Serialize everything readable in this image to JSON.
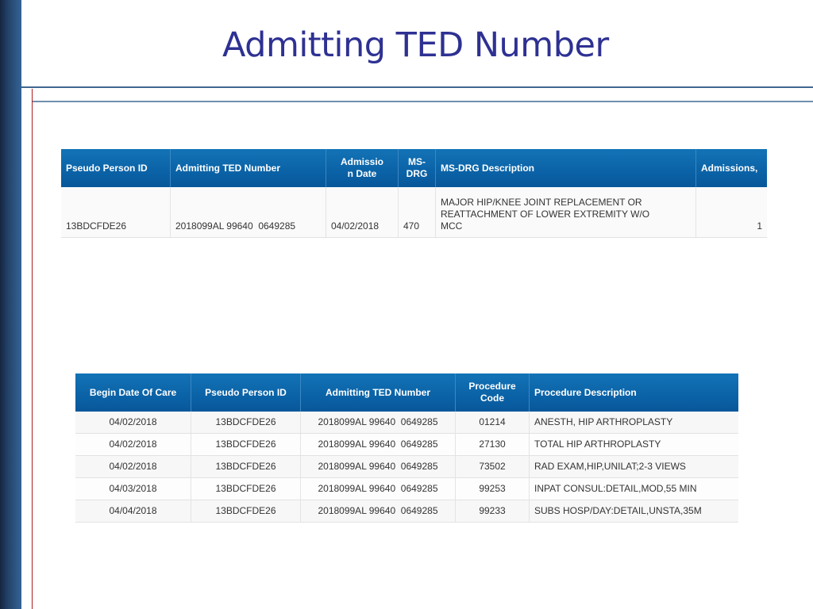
{
  "slide": {
    "title": "Admitting TED Number"
  },
  "admissions_table": {
    "headers": [
      "Pseudo Person ID",
      "Admitting TED Number",
      "Admissio n Date",
      "MS-DRG",
      "MS-DRG Description",
      "Admissions,"
    ],
    "rows": [
      {
        "pseudo_person_id": "13BDCFDE26",
        "admitting_ted_number": "2018099AL 99640  0649285",
        "admission_date": "04/02/2018",
        "ms_drg": "470",
        "ms_drg_description": "MAJOR HIP/KNEE JOINT REPLACEMENT OR REATTACHMENT OF LOWER EXTREMITY W/O MCC",
        "admissions": "1"
      }
    ]
  },
  "procedures_table": {
    "headers": [
      "Begin Date Of Care",
      "Pseudo Person ID",
      "Admitting TED Number",
      "Procedure Code",
      "Procedure Description"
    ],
    "rows": [
      {
        "begin_date": "04/02/2018",
        "pseudo_person_id": "13BDCFDE26",
        "admitting_ted_number": "2018099AL 99640  0649285",
        "procedure_code": "01214",
        "procedure_description": "ANESTH, HIP ARTHROPLASTY"
      },
      {
        "begin_date": "04/02/2018",
        "pseudo_person_id": "13BDCFDE26",
        "admitting_ted_number": "2018099AL 99640  0649285",
        "procedure_code": "27130",
        "procedure_description": "TOTAL HIP ARTHROPLASTY"
      },
      {
        "begin_date": "04/02/2018",
        "pseudo_person_id": "13BDCFDE26",
        "admitting_ted_number": "2018099AL 99640  0649285",
        "procedure_code": "73502",
        "procedure_description": "RAD EXAM,HIP,UNILAT;2-3 VIEWS"
      },
      {
        "begin_date": "04/03/2018",
        "pseudo_person_id": "13BDCFDE26",
        "admitting_ted_number": "2018099AL 99640  0649285",
        "procedure_code": "99253",
        "procedure_description": "INPAT CONSUL:DETAIL,MOD,55 MIN"
      },
      {
        "begin_date": "04/04/2018",
        "pseudo_person_id": "13BDCFDE26",
        "admitting_ted_number": "2018099AL 99640  0649285",
        "procedure_code": "99233",
        "procedure_description": "SUBS HOSP/DAY:DETAIL,UNSTA,35M"
      }
    ]
  },
  "colors": {
    "title": "#2e3192",
    "header_blue": "#0b62a6",
    "accent_red_line": "#b01c1c",
    "rule_blue": "#3e6690"
  }
}
